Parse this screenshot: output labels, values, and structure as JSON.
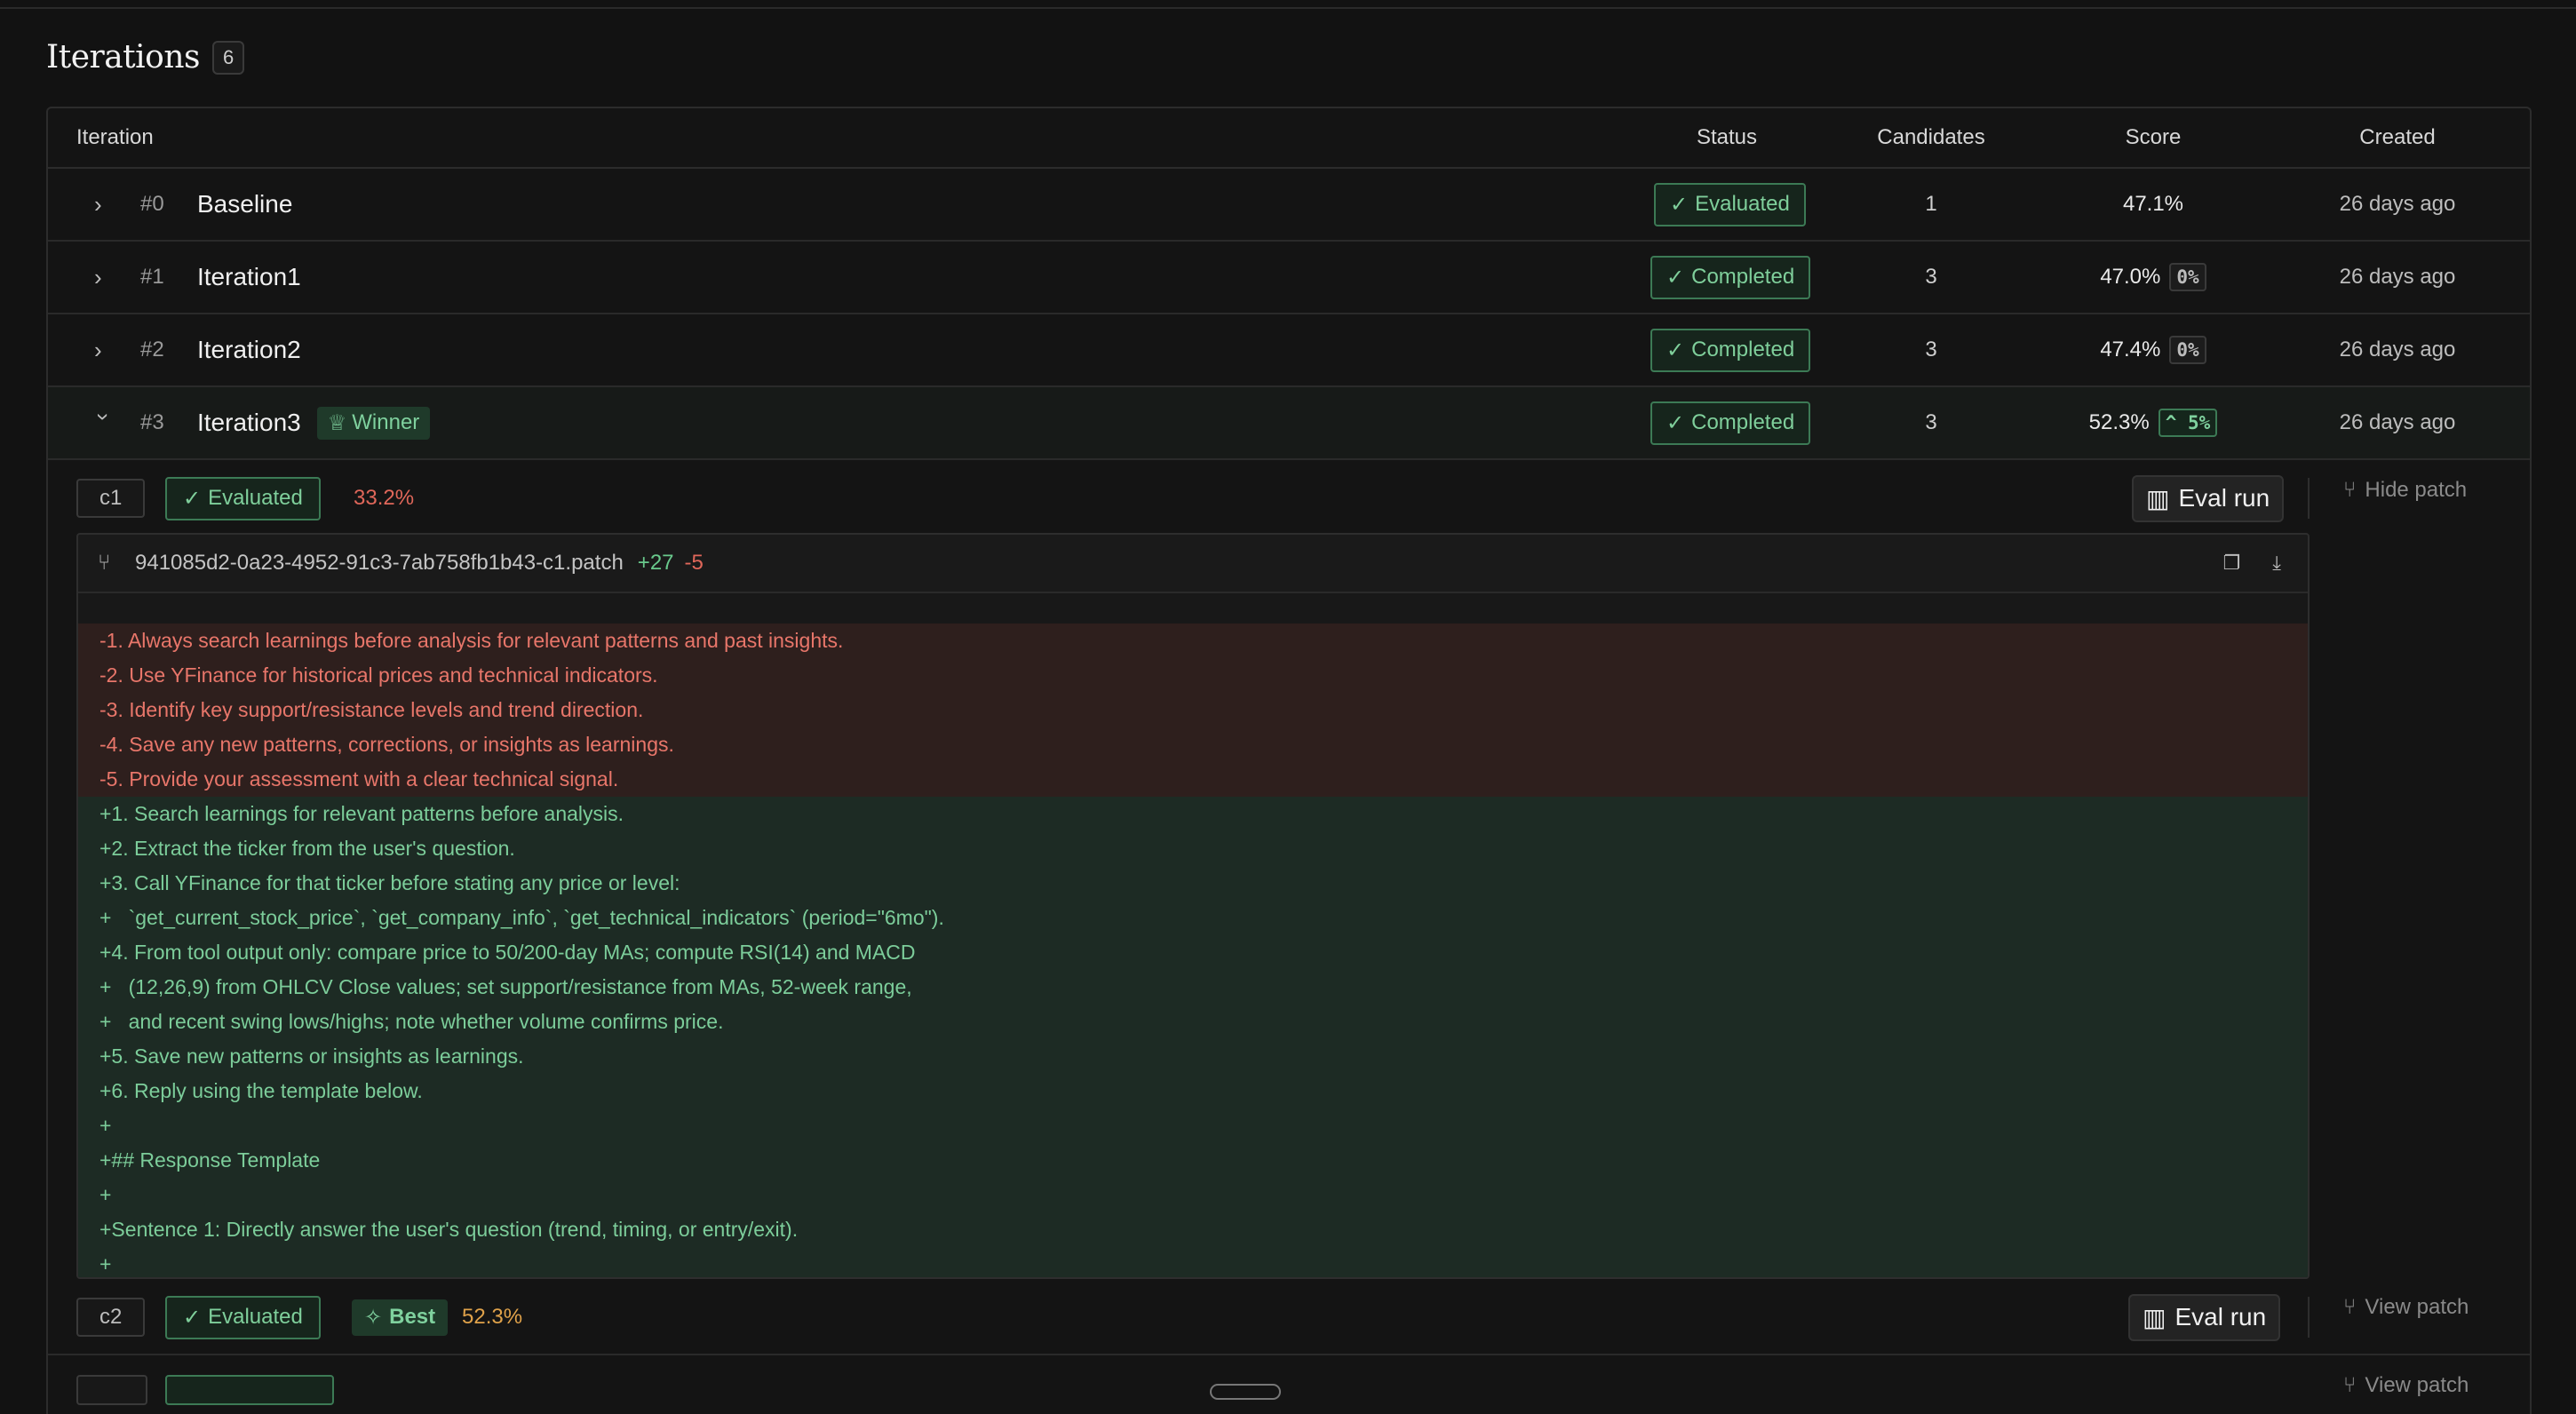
{
  "section": {
    "title": "Iterations",
    "count": "6"
  },
  "columns": {
    "iteration": "Iteration",
    "status": "Status",
    "candidates": "Candidates",
    "score": "Score",
    "created": "Created"
  },
  "iterations": [
    {
      "num": "#0",
      "name": "Baseline",
      "status": "Evaluated",
      "candidates": "1",
      "score": "47.1%",
      "delta": "",
      "created": "26 days ago"
    },
    {
      "num": "#1",
      "name": "Iteration1",
      "status": "Completed",
      "candidates": "3",
      "score": "47.0%",
      "delta": "0%",
      "created": "26 days ago"
    },
    {
      "num": "#2",
      "name": "Iteration2",
      "status": "Completed",
      "candidates": "3",
      "score": "47.4%",
      "delta": "0%",
      "created": "26 days ago"
    },
    {
      "num": "#3",
      "name": "Iteration3",
      "badge": "Winner",
      "status": "Completed",
      "candidates": "3",
      "score": "52.3%",
      "delta": "5%",
      "created": "26 days ago"
    }
  ],
  "candidates": [
    {
      "id": "c1",
      "status": "Evaluated",
      "score": "33.2%",
      "eval_button": "Eval run",
      "patch_toggle": "Hide patch"
    },
    {
      "id": "c2",
      "status": "Evaluated",
      "badge": "Best",
      "score": "52.3%",
      "eval_button": "Eval run",
      "patch_toggle": "View patch"
    },
    {
      "id": "",
      "status": "",
      "patch_toggle": "View patch"
    }
  ],
  "patch": {
    "filename": "941085d2-0a23-4952-91c3-7ab758fb1b43-c1.patch",
    "additions": "+27",
    "deletions": "-5",
    "lines": [
      {
        "type": "del",
        "text": "-1. Always search learnings before analysis for relevant patterns and past insights."
      },
      {
        "type": "del",
        "text": "-2. Use YFinance for historical prices and technical indicators."
      },
      {
        "type": "del",
        "text": "-3. Identify key support/resistance levels and trend direction."
      },
      {
        "type": "del",
        "text": "-4. Save any new patterns, corrections, or insights as learnings."
      },
      {
        "type": "del",
        "text": "-5. Provide your assessment with a clear technical signal."
      },
      {
        "type": "add",
        "text": "+1. Search learnings for relevant patterns before analysis."
      },
      {
        "type": "add",
        "text": "+2. Extract the ticker from the user's question."
      },
      {
        "type": "add",
        "text": "+3. Call YFinance for that ticker before stating any price or level:"
      },
      {
        "type": "add",
        "text": "+   `get_current_stock_price`, `get_company_info`, `get_technical_indicators` (period=\"6mo\")."
      },
      {
        "type": "add",
        "text": "+4. From tool output only: compare price to 50/200-day MAs; compute RSI(14) and MACD"
      },
      {
        "type": "add",
        "text": "+   (12,26,9) from OHLCV Close values; set support/resistance from MAs, 52-week range,"
      },
      {
        "type": "add",
        "text": "+   and recent swing lows/highs; note whether volume confirms price."
      },
      {
        "type": "add",
        "text": "+5. Save new patterns or insights as learnings."
      },
      {
        "type": "add",
        "text": "+6. Reply using the template below."
      },
      {
        "type": "add",
        "text": "+"
      },
      {
        "type": "add",
        "text": "+## Response Template"
      },
      {
        "type": "add",
        "text": "+"
      },
      {
        "type": "add",
        "text": "+Sentence 1: Directly answer the user's question (trend, timing, or entry/exit)."
      },
      {
        "type": "add",
        "text": "+"
      }
    ]
  },
  "icons": {
    "expand": "chevron-right-icon",
    "collapse": "chevron-down-icon",
    "check": "check-icon",
    "trophy": "trophy-icon",
    "chart": "chart-icon",
    "git": "git-compare-icon",
    "copy": "clipboard-icon",
    "download": "download-icon",
    "sparkle": "sparkle-icon"
  },
  "colors": {
    "success": "#7fcf9b",
    "danger": "#e0675a",
    "warning": "#e0a24a"
  }
}
